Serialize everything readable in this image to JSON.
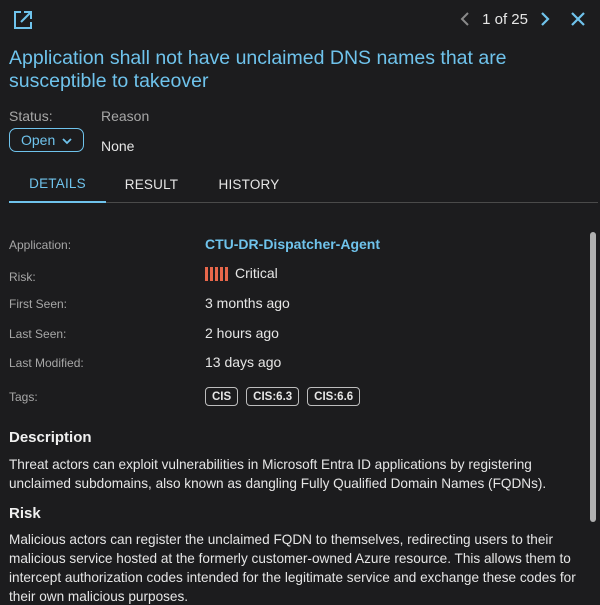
{
  "header": {
    "pager": "1 of 25"
  },
  "finding": {
    "title": "Application shall not have unclaimed DNS names that are susceptible to takeover",
    "status_label": "Status:",
    "status_value": "Open",
    "reason_label": "Reason",
    "reason_value": "None"
  },
  "tabs": [
    {
      "label": "DETAILS"
    },
    {
      "label": "RESULT"
    },
    {
      "label": "HISTORY"
    }
  ],
  "details": {
    "application_label": "Application:",
    "application_value": "CTU-DR-Dispatcher-Agent",
    "risk_label": "Risk:",
    "risk_value": "Critical",
    "first_seen_label": "First Seen:",
    "first_seen_value": "3 months ago",
    "last_seen_label": "Last Seen:",
    "last_seen_value": "2 hours ago",
    "last_modified_label": "Last Modified:",
    "last_modified_value": "13 days ago",
    "tags_label": "Tags:",
    "tags": [
      "CIS",
      "CIS:6.3",
      "CIS:6.6"
    ]
  },
  "description": {
    "heading": "Description",
    "text": "Threat actors can exploit vulnerabilities in Microsoft Entra ID applications by registering unclaimed subdomains, also known as dangling Fully Qualified Domain Names (FQDNs)."
  },
  "risk": {
    "heading": "Risk",
    "text": "Malicious actors can register the unclaimed FQDN to themselves, redirecting users to their malicious service hosted at the formerly customer-owned Azure resource. This allows them to intercept authorization codes intended for the legitimate service and exchange these codes for their own malicious purposes."
  },
  "colors": {
    "accent": "#6fc3ec",
    "critical": "#e8674b",
    "background": "#1c1c1e"
  },
  "icons": [
    "open-external-icon",
    "chevron-left-icon",
    "chevron-right-icon",
    "close-icon",
    "chevron-down-icon",
    "risk-bars-icon"
  ]
}
